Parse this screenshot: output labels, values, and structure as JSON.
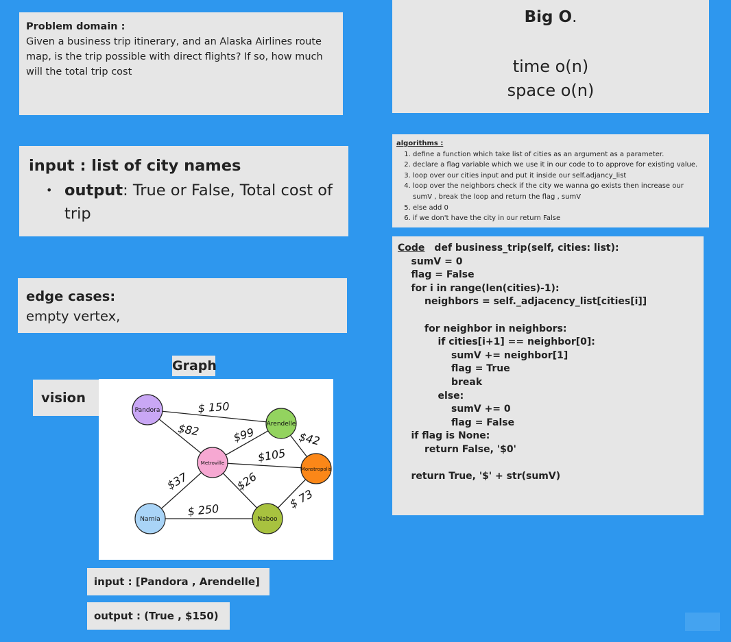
{
  "problem": {
    "heading": "Problem domain :",
    "text": "Given a business trip itinerary, and an Alaska Airlines route map, is the trip possible with direct flights? If so, how much will the total trip cost"
  },
  "bigo": {
    "title": "Big O",
    "title_suffix": ".",
    "time": "time o(n)",
    "space": "space o(n)"
  },
  "io": {
    "input": "input : list of city names",
    "output_label": "output",
    "output_text": ":  True or False, Total cost of trip"
  },
  "edge": {
    "heading": "edge cases:",
    "text": "empty vertex,"
  },
  "algorithms": {
    "heading": "algorithms :",
    "steps": [
      "define a function which take list of cities as an argument as a parameter.",
      "declare a flag variable which we use it in our code to  to approve for existing value.",
      "loop over our cities input and put it inside our self.adjancy_list",
      "loop over the neighbors check if the city we wanna go exists then increase our sumV , break the loop  and return the flag , sumV",
      "else add 0",
      "if we don't have the city in our return False"
    ]
  },
  "code": {
    "label": "Code",
    "lines": [
      "def business_trip(self, cities: list):",
      "    sumV = 0",
      "    flag = False",
      "    for i in range(len(cities)-1):",
      "        neighbors = self._adjacency_list[cities[i]]",
      "",
      "        for neighbor in neighbors:",
      "            if cities[i+1] == neighbor[0]:",
      "                sumV += neighbor[1]",
      "                flag = True",
      "                break",
      "            else:",
      "                sumV += 0",
      "                flag = False",
      "    if flag is None:",
      "        return False, '$0'",
      "",
      "    return True, '$' + str(sumV)"
    ]
  },
  "graph_label": "Graph",
  "vision_label": "vision",
  "graph": {
    "nodes": [
      {
        "id": "pandora",
        "label": "Pandora",
        "color": "#c9a7f5"
      },
      {
        "id": "arendelle",
        "label": "Arendelle",
        "color": "#93d35f"
      },
      {
        "id": "metroville",
        "label": "Metroville",
        "color": "#f6a8d2"
      },
      {
        "id": "monstropolis",
        "label": "Monstropolis",
        "color": "#fb8718"
      },
      {
        "id": "narnia",
        "label": "Narnia",
        "color": "#a9d4f7"
      },
      {
        "id": "naboo",
        "label": "Naboo",
        "color": "#a8c23f"
      }
    ],
    "edges": [
      {
        "from": "pandora",
        "to": "arendelle",
        "cost": "$ 150"
      },
      {
        "from": "pandora",
        "to": "metroville",
        "cost": "$82"
      },
      {
        "from": "metroville",
        "to": "arendelle",
        "cost": "$99"
      },
      {
        "from": "arendelle",
        "to": "monstropolis",
        "cost": "$42"
      },
      {
        "from": "metroville",
        "to": "monstropolis",
        "cost": "$105"
      },
      {
        "from": "metroville",
        "to": "narnia",
        "cost": "$37"
      },
      {
        "from": "metroville",
        "to": "naboo",
        "cost": "$26"
      },
      {
        "from": "narnia",
        "to": "naboo",
        "cost": "$ 250"
      },
      {
        "from": "naboo",
        "to": "monstropolis",
        "cost": "$ 73"
      }
    ]
  },
  "example": {
    "input": "input : [Pandora , Arendelle]",
    "output": "output : (True , $150)"
  }
}
